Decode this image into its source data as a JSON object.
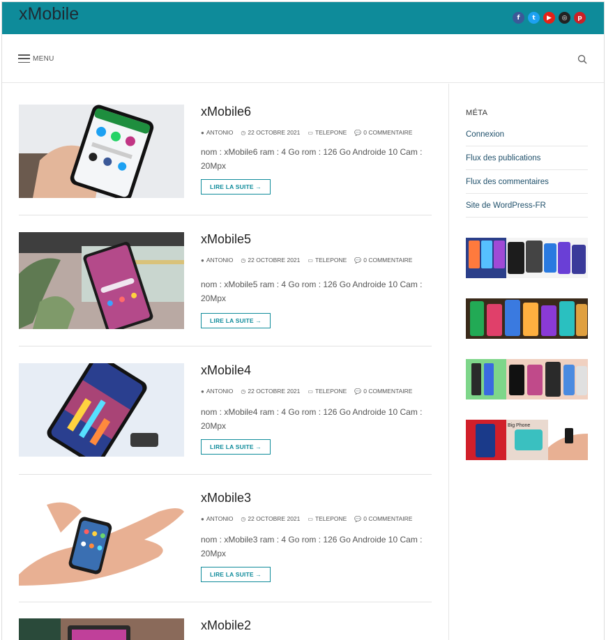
{
  "header": {
    "site_title": "xMobile",
    "social_icons": [
      {
        "name": "facebook-icon",
        "glyph": "f",
        "color": "#3b5998"
      },
      {
        "name": "twitter-icon",
        "glyph": "t",
        "color": "#1da1f2"
      },
      {
        "name": "youtube-icon",
        "glyph": "▶",
        "color": "#e62117"
      },
      {
        "name": "instagram-icon",
        "glyph": "◎",
        "color": "#222222"
      },
      {
        "name": "pinterest-icon",
        "glyph": "p",
        "color": "#cb2027"
      }
    ]
  },
  "nav": {
    "menu_label": "MENU",
    "search_icon": "search-icon"
  },
  "posts": [
    {
      "title": "xMobile6",
      "author": "ANTONIO",
      "date": "22 OCTOBRE 2021",
      "category": "TELEPONE",
      "comments": "0 COMMENTAIRE",
      "excerpt": "nom : xMobile6 ram : 4 Go rom : 126 Go Androide 10 Cam : 20Mpx",
      "read_more": "LIRE LA SUITE →"
    },
    {
      "title": "xMobile5",
      "author": "ANTONIO",
      "date": "22 OCTOBRE 2021",
      "category": "TELEPONE",
      "comments": "0 COMMENTAIRE",
      "excerpt": "nom : xMobile5 ram : 4 Go rom : 126 Go Androide 10 Cam : 20Mpx",
      "read_more": "LIRE LA SUITE →"
    },
    {
      "title": "xMobile4",
      "author": "ANTONIO",
      "date": "22 OCTOBRE 2021",
      "category": "TELEPONE",
      "comments": "0 COMMENTAIRE",
      "excerpt": "nom : xMobile4 ram : 4 Go rom : 126 Go Androide 10 Cam : 20Mpx",
      "read_more": "LIRE LA SUITE →"
    },
    {
      "title": "xMobile3",
      "author": "ANTONIO",
      "date": "22 OCTOBRE 2021",
      "category": "TELEPONE",
      "comments": "0 COMMENTAIRE",
      "excerpt": "nom : xMobile3 ram : 4 Go rom : 126 Go Androide 10 Cam : 20Mpx",
      "read_more": "LIRE LA SUITE →"
    },
    {
      "title": "xMobile2"
    }
  ],
  "sidebar": {
    "meta_title": "MÉTA",
    "meta_links": [
      "Connexion",
      "Flux des publications",
      "Flux des commentaires",
      "Site de WordPress-FR"
    ],
    "gallery_caption": "Big Phone"
  },
  "colors": {
    "accent": "#0e8b9a",
    "link": "#1e4f6a"
  }
}
